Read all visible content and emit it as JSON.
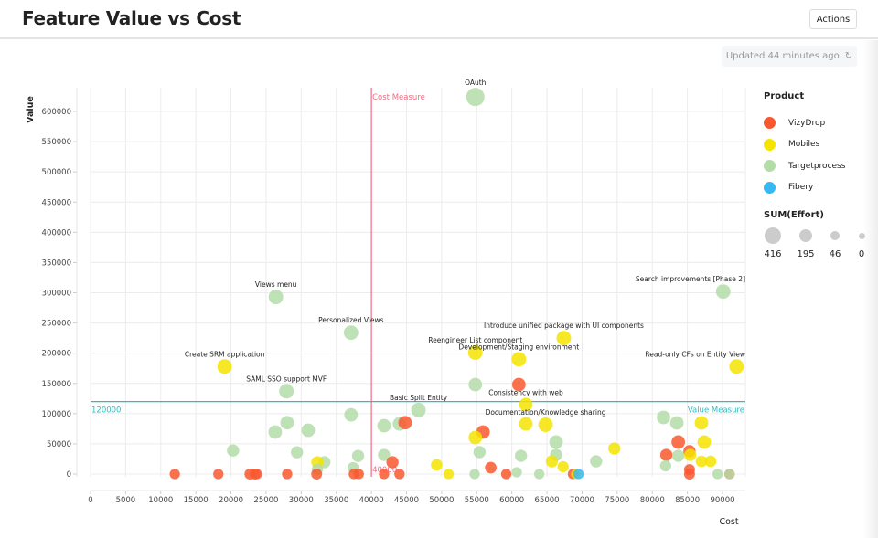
{
  "header": {
    "title": "Feature Value vs Cost",
    "actions_label": "Actions",
    "updated_text": "Updated 44 minutes ago",
    "refresh_icon": "refresh-icon"
  },
  "legend": {
    "title": "Product",
    "items": [
      {
        "label": "VizyDrop",
        "color": "#f9582f"
      },
      {
        "label": "Mobiles",
        "color": "#f5e400"
      },
      {
        "label": "Targetprocess",
        "color": "#b3dca8"
      },
      {
        "label": "Fibery",
        "color": "#36b8f2"
      }
    ],
    "size_title": "SUM(Effort)",
    "size_items": [
      "416",
      "195",
      "46",
      "0"
    ]
  },
  "chart_data": {
    "type": "scatter",
    "title": "Feature Value vs Cost",
    "xlabel": "Cost",
    "ylabel": "Value",
    "xlim": [
      0,
      90000
    ],
    "ylim": [
      0,
      600000
    ],
    "xticks": [
      "0",
      "5000",
      "10000",
      "15000",
      "20000",
      "25000",
      "30000",
      "35000",
      "40000",
      "45000",
      "50000",
      "55000",
      "60000",
      "65000",
      "70000",
      "75000",
      "80000",
      "85000",
      "90000"
    ],
    "yticks": [
      "0",
      "50000",
      "100000",
      "150000",
      "200000",
      "250000",
      "300000",
      "350000",
      "400000",
      "450000",
      "500000",
      "550000",
      "600000"
    ],
    "grid": true,
    "legend_position": "right",
    "reference_lines": [
      {
        "axis": "x",
        "value": 40000,
        "name": "Cost Measure",
        "value_label": "40000",
        "color": "#f46b86"
      },
      {
        "axis": "y",
        "value": 120000,
        "name": "Value Measure",
        "value_label": "120000",
        "color": "#2dbcc0"
      }
    ],
    "points": [
      {
        "product": "Targetprocess",
        "cost": 54800,
        "value": 624000,
        "effort": 416,
        "label": "OAuth"
      },
      {
        "product": "Targetprocess",
        "cost": 26400,
        "value": 293000,
        "effort": 195,
        "label": "Views menu"
      },
      {
        "product": "Targetprocess",
        "cost": 37100,
        "value": 234000,
        "effort": 195,
        "label": "Personalized Views"
      },
      {
        "product": "Mobiles",
        "cost": 19100,
        "value": 178000,
        "effort": 195,
        "label": "Create SRM application"
      },
      {
        "product": "Targetprocess",
        "cost": 27900,
        "value": 137000,
        "effort": 195,
        "label": "SAML SSO support MVF"
      },
      {
        "product": "Targetprocess",
        "cost": 46700,
        "value": 106000,
        "effort": 195,
        "label": "Basic Split Entity"
      },
      {
        "product": "Mobiles",
        "cost": 54800,
        "value": 201000,
        "effort": 195,
        "label": "Reengineer List component"
      },
      {
        "product": "Mobiles",
        "cost": 67400,
        "value": 225000,
        "effort": 195,
        "label": "Introduce unified package with UI components"
      },
      {
        "product": "Mobiles",
        "cost": 61000,
        "value": 190000,
        "effort": 195,
        "label": "Development/Staging environment"
      },
      {
        "product": "Targetprocess",
        "cost": 90100,
        "value": 302000,
        "effort": 195,
        "label": "Search improvements [Phase 2]"
      },
      {
        "product": "Mobiles",
        "cost": 92000,
        "value": 178000,
        "effort": 195,
        "label": "Read-only CFs on Entity View"
      },
      {
        "product": "Mobiles",
        "cost": 62000,
        "value": 115000,
        "effort": 150,
        "label": "Consistency with web"
      },
      {
        "product": "Mobiles",
        "cost": 64800,
        "value": 81600,
        "effort": 195,
        "label": "Documentation/Knowledge sharing"
      },
      {
        "product": "Targetprocess",
        "cost": 54800,
        "value": 148000,
        "effort": 150,
        "label": ""
      },
      {
        "product": "VizyDrop",
        "cost": 61000,
        "value": 148000,
        "effort": 150,
        "label": ""
      },
      {
        "product": "Targetprocess",
        "cost": 37100,
        "value": 98000,
        "effort": 150,
        "label": ""
      },
      {
        "product": "Targetprocess",
        "cost": 41800,
        "value": 80000,
        "effort": 150,
        "label": ""
      },
      {
        "product": "Targetprocess",
        "cost": 44000,
        "value": 83000,
        "effort": 150,
        "label": ""
      },
      {
        "product": "VizyDrop",
        "cost": 44800,
        "value": 85000,
        "effort": 150,
        "label": ""
      },
      {
        "product": "Targetprocess",
        "cost": 28000,
        "value": 85000,
        "effort": 150,
        "label": ""
      },
      {
        "product": "Targetprocess",
        "cost": 26300,
        "value": 69500,
        "effort": 150,
        "label": ""
      },
      {
        "product": "Targetprocess",
        "cost": 31000,
        "value": 72500,
        "effort": 150,
        "label": ""
      },
      {
        "product": "Targetprocess",
        "cost": 20300,
        "value": 39000,
        "effort": 100,
        "label": ""
      },
      {
        "product": "Targetprocess",
        "cost": 29400,
        "value": 36000,
        "effort": 100,
        "label": ""
      },
      {
        "product": "Targetprocess",
        "cost": 33300,
        "value": 19600,
        "effort": 100,
        "label": ""
      },
      {
        "product": "Mobiles",
        "cost": 32300,
        "value": 19600,
        "effort": 100,
        "label": ""
      },
      {
        "product": "Targetprocess",
        "cost": 38100,
        "value": 30000,
        "effort": 100,
        "label": ""
      },
      {
        "product": "Targetprocess",
        "cost": 37400,
        "value": 10600,
        "effort": 70,
        "label": ""
      },
      {
        "product": "Targetprocess",
        "cost": 32300,
        "value": 7500,
        "effort": 70,
        "label": ""
      },
      {
        "product": "Targetprocess",
        "cost": 41800,
        "value": 31700,
        "effort": 100,
        "label": ""
      },
      {
        "product": "VizyDrop",
        "cost": 43000,
        "value": 19600,
        "effort": 100,
        "label": ""
      },
      {
        "product": "Mobiles",
        "cost": 49300,
        "value": 15100,
        "effort": 80,
        "label": ""
      },
      {
        "product": "Mobiles",
        "cost": 51000,
        "value": 0,
        "effort": 46,
        "label": ""
      },
      {
        "product": "VizyDrop",
        "cost": 12000,
        "value": 0,
        "effort": 46,
        "label": ""
      },
      {
        "product": "VizyDrop",
        "cost": 18200,
        "value": 0,
        "effort": 46,
        "label": ""
      },
      {
        "product": "VizyDrop",
        "cost": 22700,
        "value": 0,
        "effort": 60,
        "label": ""
      },
      {
        "product": "VizyDrop",
        "cost": 23400,
        "value": 0,
        "effort": 60,
        "label": ""
      },
      {
        "product": "VizyDrop",
        "cost": 23700,
        "value": 0,
        "effort": 46,
        "label": ""
      },
      {
        "product": "VizyDrop",
        "cost": 28000,
        "value": 0,
        "effort": 46,
        "label": ""
      },
      {
        "product": "VizyDrop",
        "cost": 32200,
        "value": 0,
        "effort": 60,
        "label": ""
      },
      {
        "product": "VizyDrop",
        "cost": 37500,
        "value": 0,
        "effort": 46,
        "label": ""
      },
      {
        "product": "VizyDrop",
        "cost": 38200,
        "value": 0,
        "effort": 46,
        "label": ""
      },
      {
        "product": "VizyDrop",
        "cost": 41800,
        "value": 0,
        "effort": 46,
        "label": ""
      },
      {
        "product": "VizyDrop",
        "cost": 44000,
        "value": 0,
        "effort": 46,
        "label": ""
      },
      {
        "product": "Targetprocess",
        "cost": 54700,
        "value": 0,
        "effort": 46,
        "label": ""
      },
      {
        "product": "VizyDrop",
        "cost": 55900,
        "value": 69500,
        "effort": 150,
        "label": ""
      },
      {
        "product": "Mobiles",
        "cost": 54800,
        "value": 60400,
        "effort": 150,
        "label": ""
      },
      {
        "product": "Mobiles",
        "cost": 62000,
        "value": 83000,
        "effort": 150,
        "label": ""
      },
      {
        "product": "Targetprocess",
        "cost": 66300,
        "value": 53000,
        "effort": 150,
        "label": ""
      },
      {
        "product": "Targetprocess",
        "cost": 55400,
        "value": 36300,
        "effort": 100,
        "label": ""
      },
      {
        "product": "Targetprocess",
        "cost": 61300,
        "value": 30200,
        "effort": 100,
        "label": ""
      },
      {
        "product": "Targetprocess",
        "cost": 66300,
        "value": 31700,
        "effort": 100,
        "label": ""
      },
      {
        "product": "Mobiles",
        "cost": 74600,
        "value": 42300,
        "effort": 100,
        "label": ""
      },
      {
        "product": "VizyDrop",
        "cost": 57000,
        "value": 10600,
        "effort": 80,
        "label": ""
      },
      {
        "product": "Targetprocess",
        "cost": 60700,
        "value": 3000,
        "effort": 46,
        "label": ""
      },
      {
        "product": "VizyDrop",
        "cost": 59200,
        "value": 0,
        "effort": 46,
        "label": ""
      },
      {
        "product": "Targetprocess",
        "cost": 63900,
        "value": 0,
        "effort": 46,
        "label": ""
      },
      {
        "product": "Mobiles",
        "cost": 65700,
        "value": 21100,
        "effort": 100,
        "label": ""
      },
      {
        "product": "Mobiles",
        "cost": 67300,
        "value": 12100,
        "effort": 70,
        "label": ""
      },
      {
        "product": "Targetprocess",
        "cost": 72000,
        "value": 21100,
        "effort": 100,
        "label": ""
      },
      {
        "product": "VizyDrop",
        "cost": 68700,
        "value": 0,
        "effort": 46,
        "label": ""
      },
      {
        "product": "Mobiles",
        "cost": 69100,
        "value": 0,
        "effort": 30,
        "label": ""
      },
      {
        "product": "Fibery",
        "cost": 69500,
        "value": 0,
        "effort": 46,
        "label": ""
      },
      {
        "product": "Targetprocess",
        "cost": 81600,
        "value": 93700,
        "effort": 150,
        "label": ""
      },
      {
        "product": "Targetprocess",
        "cost": 83500,
        "value": 84600,
        "effort": 150,
        "label": ""
      },
      {
        "product": "Mobiles",
        "cost": 87000,
        "value": 84600,
        "effort": 150,
        "label": ""
      },
      {
        "product": "VizyDrop",
        "cost": 83700,
        "value": 53000,
        "effort": 150,
        "label": ""
      },
      {
        "product": "Mobiles",
        "cost": 87400,
        "value": 53000,
        "effort": 150,
        "label": ""
      },
      {
        "product": "VizyDrop",
        "cost": 82000,
        "value": 31700,
        "effort": 100,
        "label": ""
      },
      {
        "product": "Targetprocess",
        "cost": 83700,
        "value": 30200,
        "effort": 100,
        "label": ""
      },
      {
        "product": "VizyDrop",
        "cost": 85300,
        "value": 37800,
        "effort": 100,
        "label": ""
      },
      {
        "product": "Mobiles",
        "cost": 85400,
        "value": 31700,
        "effort": 100,
        "label": ""
      },
      {
        "product": "Mobiles",
        "cost": 87000,
        "value": 21100,
        "effort": 80,
        "label": ""
      },
      {
        "product": "Mobiles",
        "cost": 88300,
        "value": 21100,
        "effort": 80,
        "label": ""
      },
      {
        "product": "Targetprocess",
        "cost": 81900,
        "value": 13600,
        "effort": 70,
        "label": ""
      },
      {
        "product": "VizyDrop",
        "cost": 85300,
        "value": 7500,
        "effort": 60,
        "label": ""
      },
      {
        "product": "VizyDrop",
        "cost": 85300,
        "value": 0,
        "effort": 60,
        "label": ""
      },
      {
        "product": "Targetprocess",
        "cost": 89300,
        "value": 0,
        "effort": 46,
        "label": ""
      },
      {
        "product": "VizyDrop",
        "cost": 91000,
        "value": 0,
        "effort": 46,
        "label": ""
      },
      {
        "product": "Targetprocess",
        "cost": 91000,
        "value": 0,
        "effort": 46,
        "label": ""
      }
    ]
  }
}
